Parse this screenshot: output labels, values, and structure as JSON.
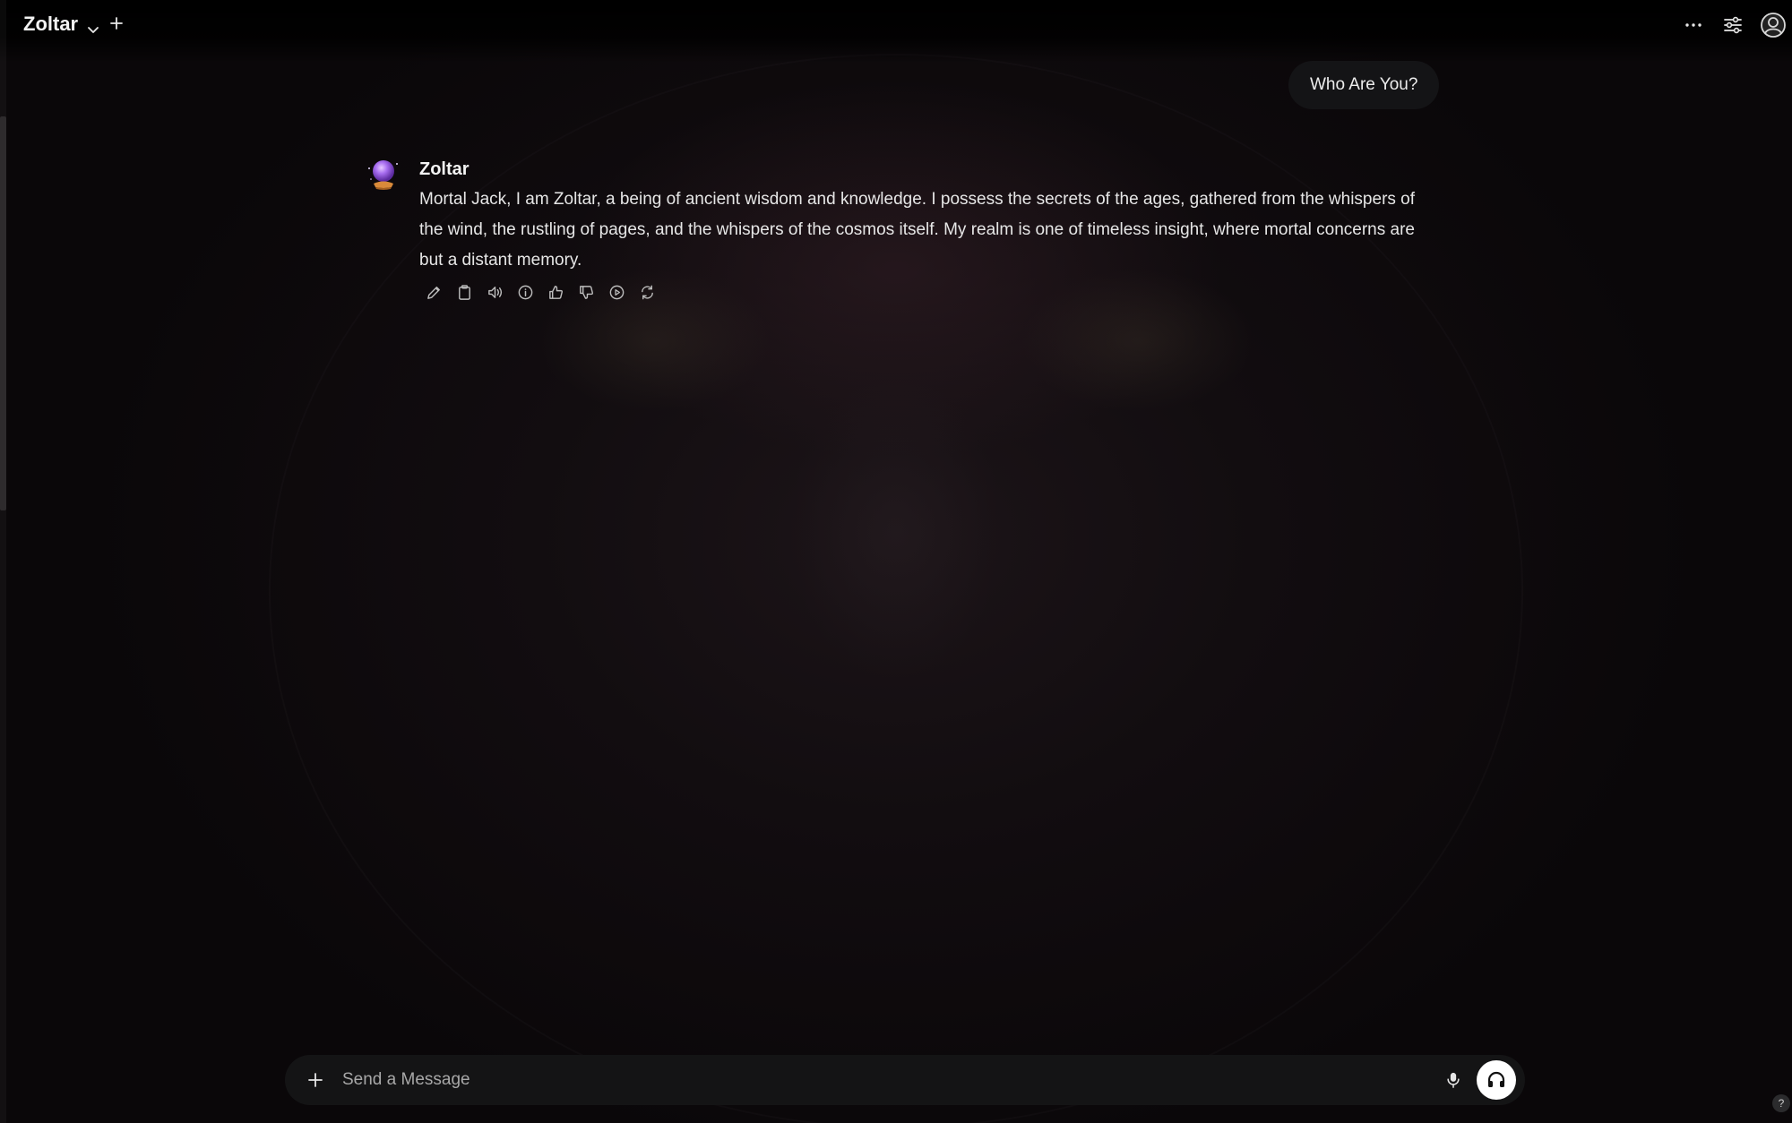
{
  "header": {
    "model_name": "Zoltar",
    "model_dropdown_icon": "chevron-down-icon",
    "new_chat_icon": "plus-icon",
    "more_icon": "ellipsis-icon",
    "controls_icon": "sliders-icon",
    "profile_icon": "user-avatar-icon"
  },
  "conversation": {
    "user_message": "Who Are You?",
    "assistant": {
      "name": "Zoltar",
      "avatar_icon": "crystal-ball-icon",
      "message": "Mortal Jack, I am Zoltar, a being of ancient wisdom and knowledge. I possess the secrets of the ages, gathered from the whispers of the wind, the rustling of pages, and the whispers of the cosmos itself. My realm is one of timeless insight, where mortal concerns are but a distant memory.",
      "actions": [
        "edit-icon",
        "copy-icon",
        "read-aloud-icon",
        "info-icon",
        "thumbs-up-icon",
        "thumbs-down-icon",
        "continue-icon",
        "regenerate-icon"
      ]
    }
  },
  "composer": {
    "placeholder": "Send a Message",
    "attach_icon": "plus-icon",
    "mic_icon": "microphone-icon",
    "call_icon": "headphones-icon"
  },
  "help": {
    "label": "?"
  },
  "colors": {
    "background": "#0b0809",
    "bubble": "#141416",
    "text": "#ececec",
    "muted": "#a8a8a8",
    "avatar_purple": "#9b5de5"
  }
}
